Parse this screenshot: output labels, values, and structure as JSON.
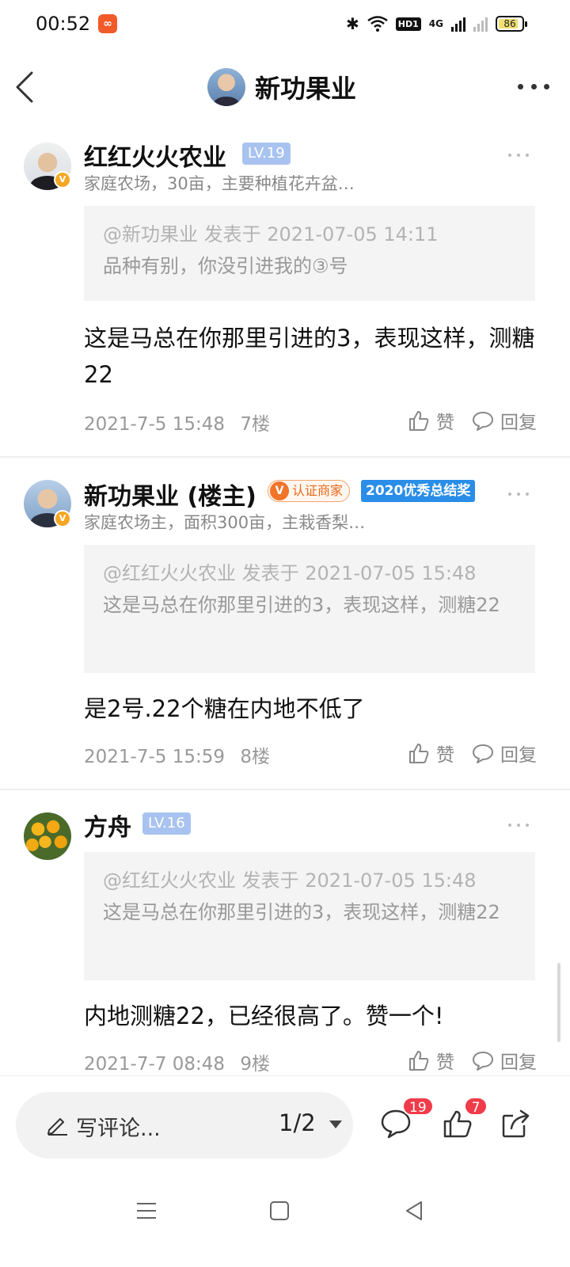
{
  "status_bar": {
    "time": "00:52",
    "app_icon": "app-notification-icon",
    "network": "4G",
    "hd_label": "HD1",
    "battery": "86"
  },
  "header": {
    "title": "新功果业"
  },
  "posts": [
    {
      "username": "红红火火农业",
      "level": "LV.19",
      "description": "家庭农场，30亩，主要种植花卉盆…",
      "quote_head": "@新功果业 发表于 2021-07-05 14:11",
      "quote_body": "品种有别，你没引进我的③号",
      "content": "这是马总在你那里引进的3，表现这样，测糖22",
      "date": "2021-7-5 15:48",
      "floor": "7楼",
      "like_label": "赞",
      "reply_label": "回复"
    },
    {
      "username": "新功果业 (楼主)",
      "cert_label": "认证商家",
      "cert_icon": "V",
      "award_label": "2020优秀总结奖",
      "description": "家庭农场主，面积300亩，主栽香梨…",
      "quote_head": "@红红火火农业 发表于 2021-07-05 15:48",
      "quote_body": "这是马总在你那里引进的3，表现这样，测糖22",
      "content": "是2号.22个糖在内地不低了",
      "date": "2021-7-5 15:59",
      "floor": "8楼",
      "like_label": "赞",
      "reply_label": "回复"
    },
    {
      "username": "方舟",
      "level": "LV.16",
      "quote_head": "@红红火火农业 发表于 2021-07-05 15:48",
      "quote_body": "这是马总在你那里引进的3，表现这样，测糖22",
      "content": "内地测糖22，已经很高了。赞一个!",
      "date": "2021-7-7 08:48",
      "floor": "9楼",
      "like_label": "赞",
      "reply_label": "回复"
    }
  ],
  "bottom_bar": {
    "comment_placeholder": "写评论...",
    "page_indicator": "1/2",
    "comment_count": "19",
    "like_count": "7"
  },
  "colors": {
    "level_badge": "#a9c3f0",
    "badge_red": "#f03c4a",
    "cert_orange": "#f0742a",
    "award_blue": "#2a8ee8",
    "verified_yellow": "#f5a623"
  }
}
